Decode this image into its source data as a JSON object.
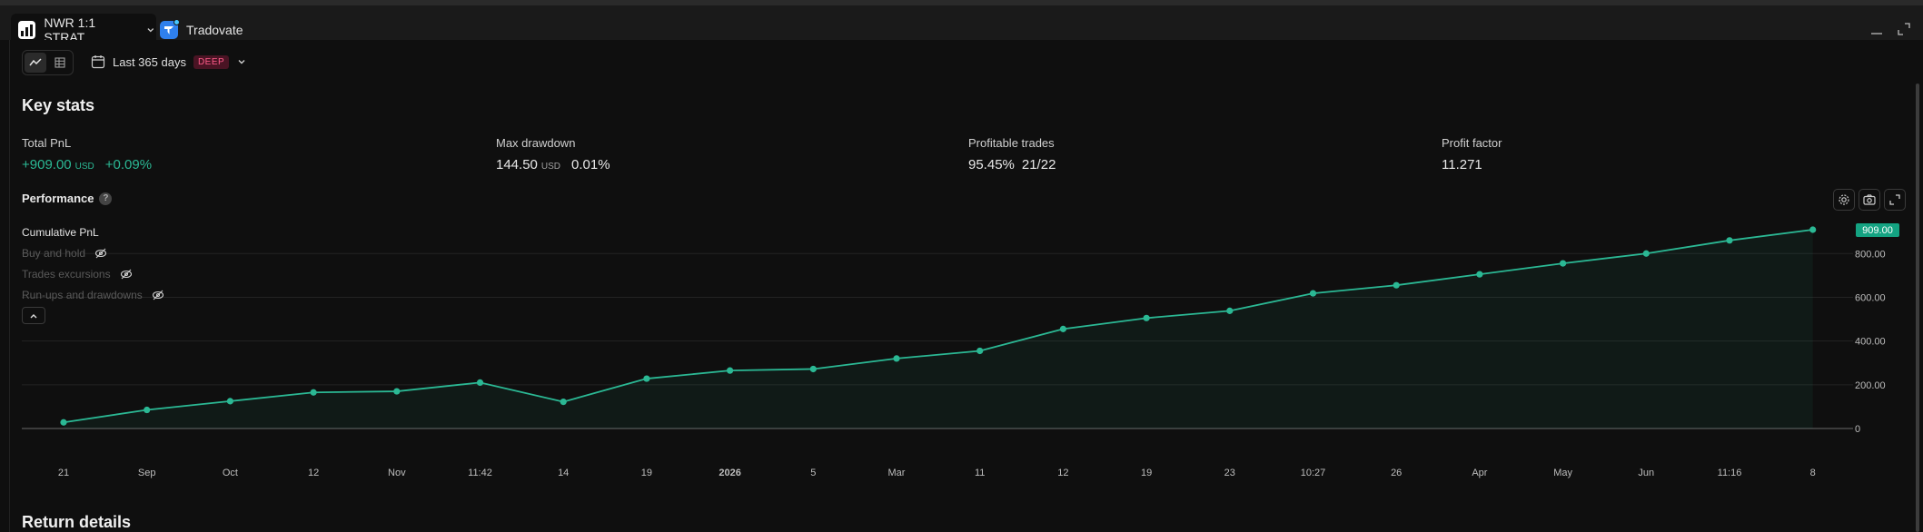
{
  "tabs": {
    "active": {
      "label": "NWR 1:1 STRAT",
      "icon": "chart-logo-icon"
    },
    "inactive": {
      "label": "Tradovate",
      "icon": "tradovate-icon"
    }
  },
  "toolbar": {
    "date_range": "Last 365 days",
    "badge": "DEEP"
  },
  "key_stats": {
    "title": "Key stats",
    "total_pnl": {
      "label": "Total PnL",
      "value": "+909.00",
      "unit": "USD",
      "percent": "+0.09%"
    },
    "max_drawdown": {
      "label": "Max drawdown",
      "value": "144.50",
      "unit": "USD",
      "percent": "0.01%"
    },
    "profitable_trades": {
      "label": "Profitable trades",
      "percent": "95.45%",
      "ratio": "21/22"
    },
    "profit_factor": {
      "label": "Profit factor",
      "value": "11.271"
    }
  },
  "performance": {
    "title": "Performance",
    "help": "?",
    "legend": [
      {
        "label": "Cumulative PnL",
        "visible": true
      },
      {
        "label": "Buy and hold",
        "visible": false
      },
      {
        "label": "Trades excursions",
        "visible": false
      },
      {
        "label": "Run-ups and drawdowns",
        "visible": false
      }
    ]
  },
  "return_details": {
    "title": "Return details"
  },
  "colors": {
    "accent": "#2bb894",
    "badge_bg": "#4a1424",
    "badge_fg": "#ff5c8a"
  },
  "chart_data": {
    "type": "area",
    "x": [
      "21",
      "Sep",
      "Oct",
      "12",
      "Nov",
      "11:42",
      "14",
      "19",
      "2026",
      "5",
      "Mar",
      "11",
      "12",
      "19",
      "23",
      "10:27",
      "26",
      "Apr",
      "May",
      "Jun",
      "11:16",
      "8"
    ],
    "series": [
      {
        "name": "Cumulative PnL",
        "values": [
          28,
          85,
          125,
          165,
          170,
          210,
          122,
          228,
          265,
          272,
          320,
          355,
          455,
          505,
          538,
          618,
          655,
          705,
          755,
          800,
          860,
          909
        ]
      }
    ],
    "ylim": [
      0,
      909
    ],
    "y_ticks": [
      "0",
      "200.00",
      "400.00",
      "600.00",
      "800.00"
    ],
    "last_value_label": "909.00",
    "grid": true
  }
}
